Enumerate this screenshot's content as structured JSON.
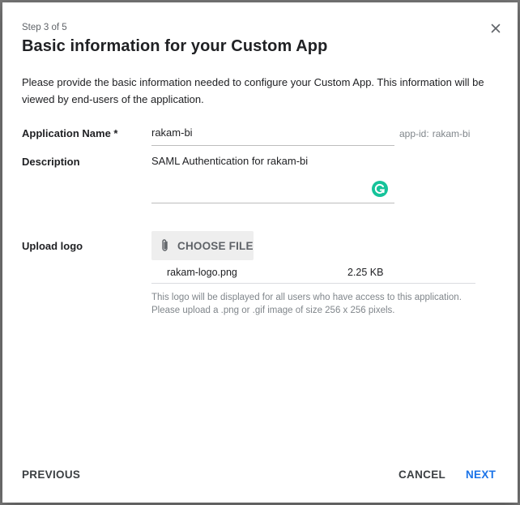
{
  "backdrop": {
    "hint": ""
  },
  "dialog": {
    "step": "Step 3 of 5",
    "title": "Basic information for your Custom App",
    "intro": "Please provide the basic information needed to configure your Custom App. This information will be viewed by end-users of the application.",
    "close_icon": "close-icon"
  },
  "form": {
    "app_name_label": "Application Name *",
    "app_name_value": "rakam-bi",
    "app_id_prefix": "app-id:",
    "app_id_value": "rakam-bi",
    "description_label": "Description",
    "description_value": "SAML Authentication for rakam-bi",
    "upload_label": "Upload logo",
    "choose_file_label": "CHOOSE FILE",
    "file_name": "rakam-logo.png",
    "file_size": "2.25 KB",
    "help_line1": "This logo will be displayed for all users who have access to this application.",
    "help_line2": "Please upload a .png or .gif image of size 256 x 256 pixels."
  },
  "footer": {
    "previous_label": "PREVIOUS",
    "cancel_label": "CANCEL",
    "next_label": "NEXT"
  },
  "colors": {
    "accent": "#1a73e8",
    "grammarly": "#15c39a"
  }
}
